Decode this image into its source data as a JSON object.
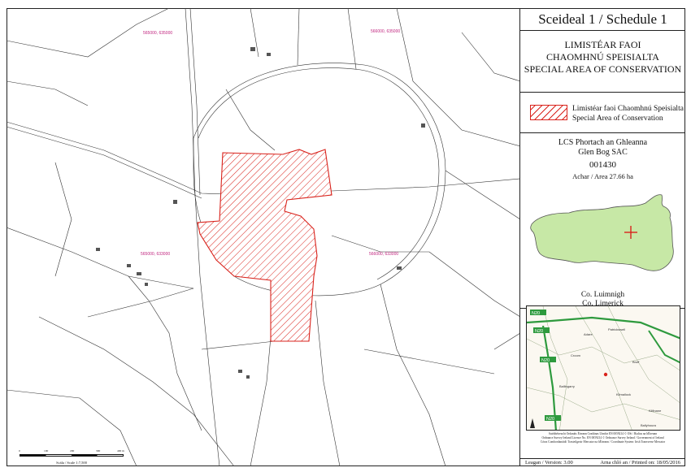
{
  "title": "Sceideal 1 / Schedule 1",
  "designation": {
    "line1": "LIMISTÉAR FAOI",
    "line2": "CHAOMHNÚ SPEISIALTA",
    "line3": "SPECIAL AREA OF CONSERVATION"
  },
  "legend": {
    "line1": "Limistéar faoi Chaomhnú Speisialta",
    "line2": "Special Area of Conservation",
    "color": "#d9231c"
  },
  "site": {
    "name_irish": "LCS Phortach an Ghleanna",
    "name_english": "Glen Bog SAC",
    "code": "001430",
    "area": "Achar / Area 27.66 ha",
    "county_irish": "Co. Luimnigh",
    "county_english": "Co. Limerick"
  },
  "map": {
    "grid_labels": [
      "565000, 635000",
      "566000, 635000",
      "565000, 633000",
      "566000, 633000"
    ],
    "road_labels": [
      "N20",
      "N20",
      "N20",
      "N20"
    ],
    "inset_places": [
      "Croom",
      "Adare",
      "Ballingarry",
      "Patrickswell",
      "Kilmallock",
      "Bruff",
      "Kilfinane",
      "Ballyhoura"
    ]
  },
  "credits": {
    "line1": "Suirbhéireacht Ordanáis Éireann Ceadúnas Uimhir EN 0059214 © OSi / Rialtas na hÉireann",
    "line2": "Ordnance Survey Ireland Licence No. EN 0059214 © Ordnance Survey Ireland / Government of Ireland",
    "line3": "Córas Comhordanáidí: Trasteilgeoir Mercator na hÉireann / Coordinate System: Irish Transverse Mercator"
  },
  "scale": {
    "ticks": [
      "0",
      "100",
      "200",
      "300",
      "400 m"
    ],
    "label": "Scála / Scale 1:7,500"
  },
  "footer": {
    "version": "Leagan / Version: 3.00",
    "printed": "Arna chló an / Printed on: 18/05/2016"
  }
}
